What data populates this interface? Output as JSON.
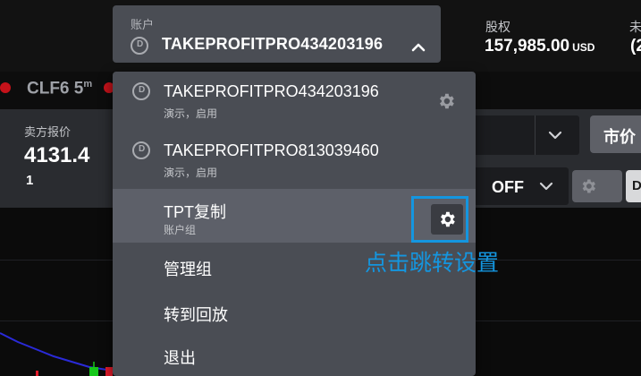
{
  "header": {
    "account_label": "账户",
    "account_value": "TAKEPROFITPRO434203196",
    "equity_label": "股权",
    "equity_value": "157,985.00",
    "equity_currency": "USD",
    "unrealized_label": "未",
    "unrealized_value": "(2"
  },
  "symbol": {
    "name": "CLF6",
    "timeframe": "5",
    "timeframe_sup": "m"
  },
  "quote": {
    "bid_label": "卖方报价",
    "bid_price": "4131.4",
    "bid_size": "1"
  },
  "order": {
    "type_label": "市价",
    "toggle_value": "OFF",
    "d_label": "D"
  },
  "menu": {
    "accounts": [
      {
        "name": "TAKEPROFITPRO434203196",
        "status": "演示，启用",
        "icon": "d-circle-icon"
      },
      {
        "name": "TAKEPROFITPRO813039460",
        "status": "演示，启用",
        "icon": "d-circle-icon"
      }
    ],
    "group": {
      "name": "TPT复制",
      "sub": "账户组"
    },
    "actions": [
      "管理组",
      "转到回放",
      "退出"
    ]
  },
  "annotation": {
    "text": "点击跳转设置",
    "color": "#1496e0"
  },
  "colors": {
    "menu_bg": "#4a4d54",
    "active_bg": "#5d6069",
    "accent": "#1496e0",
    "red_dot": "#c5121a"
  }
}
